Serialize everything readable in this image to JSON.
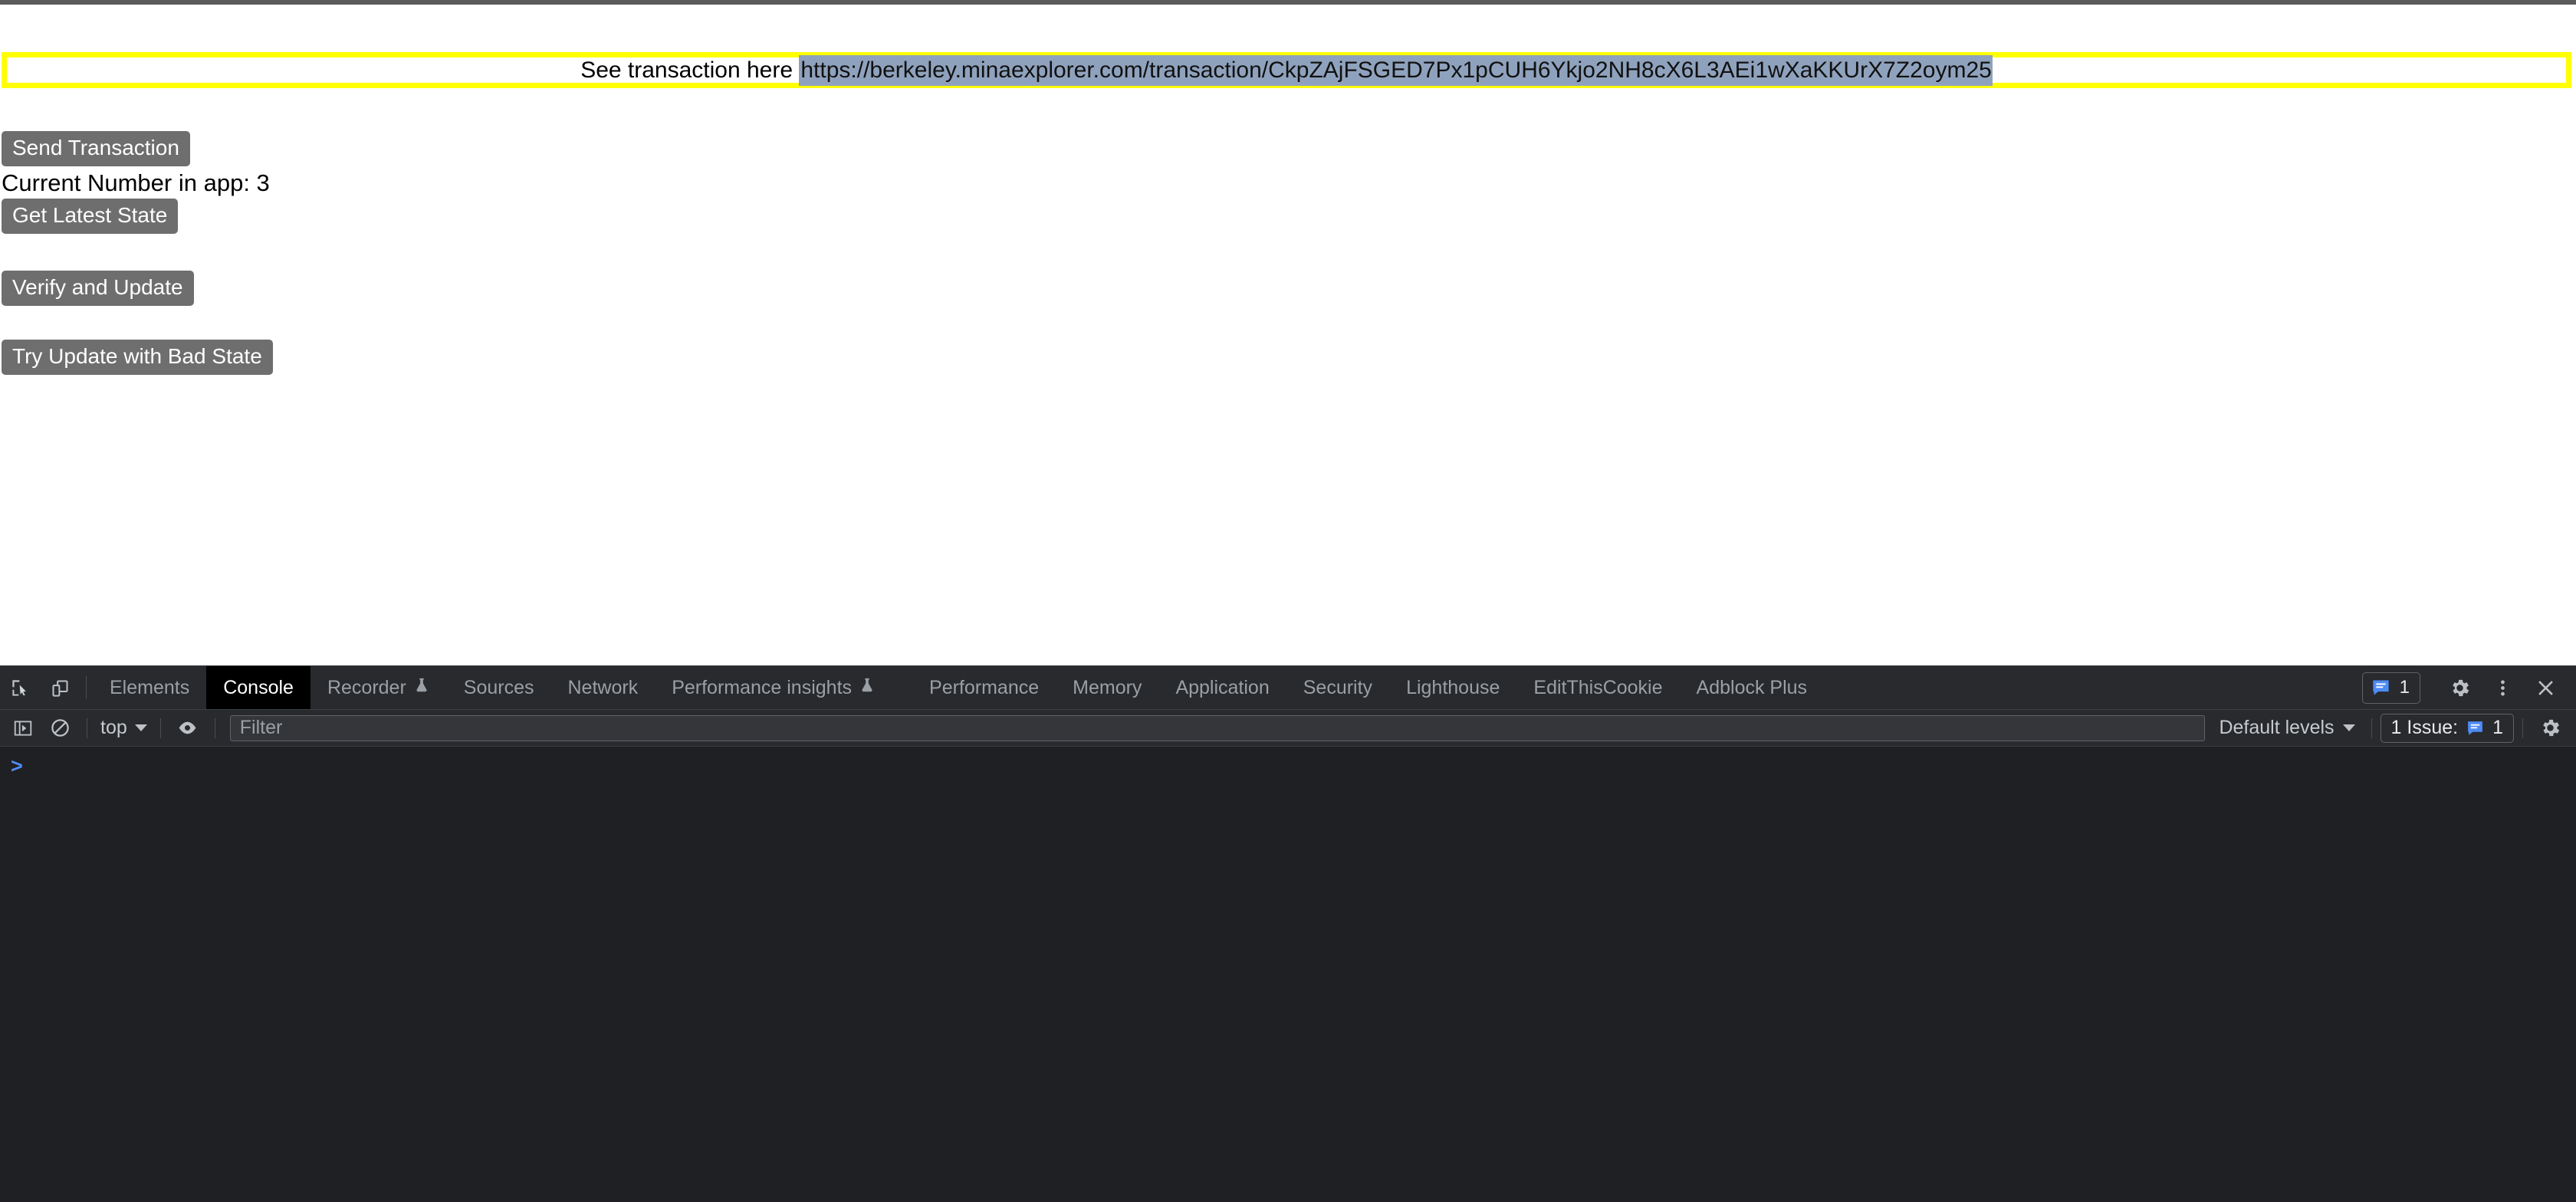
{
  "page": {
    "transaction_notice": {
      "label": "See transaction here ",
      "url": "https://berkeley.minaexplorer.com/transaction/CkpZAjFSGED7Px1pCUH6Ykjo2NH8cX6L3AEi1wXaKKUrX7Z2oym25",
      "highlight_color": "#ffff00",
      "selection_color": "#8fa2bd"
    },
    "buttons": {
      "send_transaction": "Send Transaction",
      "get_latest_state": "Get Latest State",
      "verify_and_update": "Verify and Update",
      "try_update_bad_state": "Try Update with Bad State"
    },
    "status": {
      "current_number": "Current Number in app: 3"
    }
  },
  "devtools": {
    "tabs": [
      {
        "label": "Elements",
        "active": false,
        "experiment": false
      },
      {
        "label": "Console",
        "active": true,
        "experiment": false
      },
      {
        "label": "Recorder",
        "active": false,
        "experiment": true
      },
      {
        "label": "Sources",
        "active": false,
        "experiment": false
      },
      {
        "label": "Network",
        "active": false,
        "experiment": false
      },
      {
        "label": "Performance insights",
        "active": false,
        "experiment": true
      },
      {
        "label": "Performance",
        "active": false,
        "experiment": false
      },
      {
        "label": "Memory",
        "active": false,
        "experiment": false
      },
      {
        "label": "Application",
        "active": false,
        "experiment": false
      },
      {
        "label": "Security",
        "active": false,
        "experiment": false
      },
      {
        "label": "Lighthouse",
        "active": false,
        "experiment": false
      },
      {
        "label": "EditThisCookie",
        "active": false,
        "experiment": false
      },
      {
        "label": "Adblock Plus",
        "active": false,
        "experiment": false
      }
    ],
    "tabbar_right": {
      "issue_count": "1"
    },
    "console_toolbar": {
      "context": "top",
      "filter_placeholder": "Filter",
      "filter_value": "",
      "levels": "Default levels",
      "issues_label": "1 Issue:",
      "issues_count": "1"
    },
    "console": {
      "prompt": ">"
    },
    "colors": {
      "panel_bg": "#282a2d",
      "console_bg": "#1f2023",
      "accent_blue": "#4f8bf5",
      "text": "#e8eaed",
      "muted_text": "#9aa0a6"
    }
  }
}
